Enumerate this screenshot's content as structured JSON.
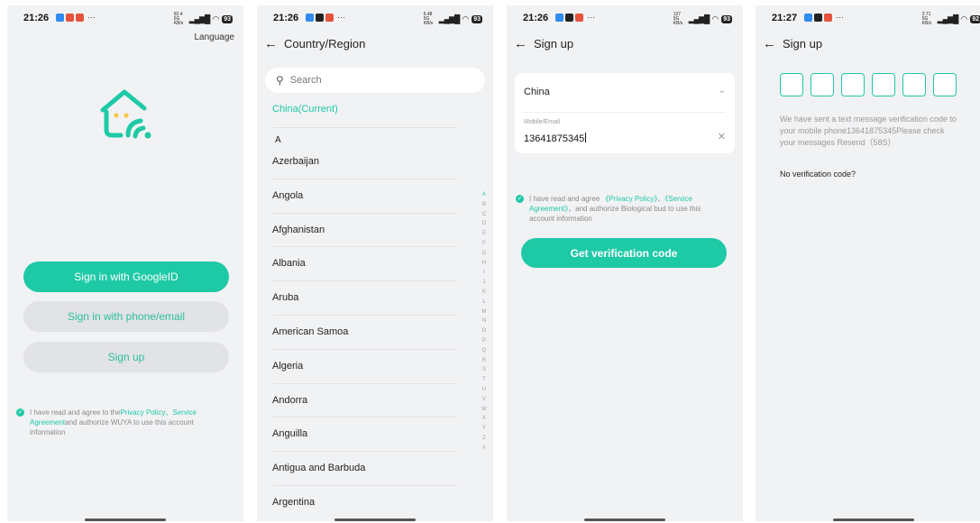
{
  "status_bars": [
    {
      "time": "21:26",
      "net": "92.4 5G KB/s",
      "battery": "93"
    },
    {
      "time": "21:26",
      "net": "6.48 5G KB/s",
      "battery": "93"
    },
    {
      "time": "21:26",
      "net": "127 5G KB/s",
      "battery": "93"
    },
    {
      "time": "21:27",
      "net": "2.71 5G KB/s",
      "battery": "92"
    }
  ],
  "colors": {
    "accent": "#1ec9a6",
    "screen_bg": "#f1f2f4",
    "grey_button": "#e2e3e6"
  },
  "login": {
    "language_label": "Language",
    "google_button": "Sign in with GoogleID",
    "phone_button": "Sign in with phone/email",
    "signup_button": "Sign up",
    "agreement": {
      "prefix": "I have read and agree to the",
      "privacy": "Privacy Policy",
      "sep": "、",
      "service": "Service Agreement",
      "suffix": "and authorize WUYA to use this account information"
    }
  },
  "country": {
    "title": "Country/Region",
    "search_placeholder": "Search",
    "current": "China(Current)",
    "section_letter": "A",
    "countries": [
      "Azerbaijan",
      "Angola",
      "Afghanistan",
      "Albania",
      "Aruba",
      "American Samoa",
      "Algeria",
      "Andorra",
      "Anguilla",
      "Antigua and Barbuda",
      "Argentina"
    ],
    "alphabet": [
      "A",
      "B",
      "C",
      "D",
      "E",
      "F",
      "G",
      "H",
      "I",
      "J",
      "K",
      "L",
      "M",
      "N",
      "O",
      "P",
      "Q",
      "R",
      "S",
      "T",
      "U",
      "V",
      "W",
      "X",
      "Y",
      "Z",
      "#"
    ]
  },
  "signup": {
    "title": "Sign up",
    "country_value": "China",
    "field_label": "Mobile/Email",
    "field_value": "13641875345",
    "agreement": {
      "prefix": "I have read and agree ",
      "privacy": "《Privacy Policy》",
      "sep": "、",
      "service": "《Service Agreement》",
      "suffix": "，and authorize Biological bud to use this account information"
    },
    "button": "Get verification code"
  },
  "verify": {
    "title": "Sign up",
    "message": "We have sent a text message verification code to your mobile phone13641875345Please check your messages  Resend（58S）",
    "no_code": "No verification code?"
  }
}
